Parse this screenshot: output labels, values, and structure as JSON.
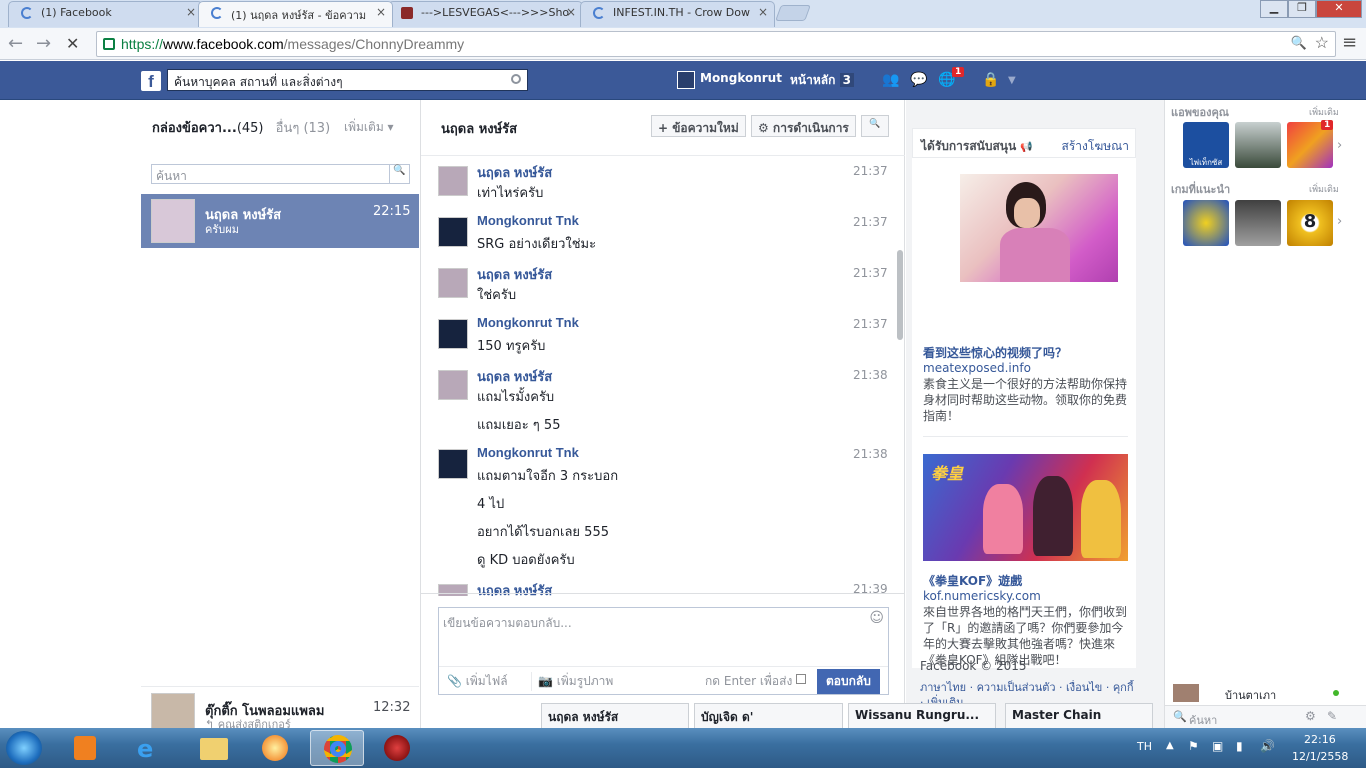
{
  "browser": {
    "tabs": [
      {
        "title": "(1) Facebook",
        "close": "×",
        "active": false
      },
      {
        "title": "(1) นฤดล หงษ์รัส - ข้อความ",
        "close": "×",
        "active": true
      },
      {
        "title": "--->LESVEGAS<--->>>Sho",
        "close": "×",
        "active": false
      },
      {
        "title": "INFEST.IN.TH - Crow Dow",
        "close": "×",
        "active": false
      }
    ],
    "url_scheme": "https://",
    "url_host": "www.facebook.com",
    "url_path": "/messages/ChonnyDreammy",
    "back": "←",
    "forward": "→",
    "stop": "✕",
    "window_buttons": {
      "minimize": "▁",
      "maximize": "❐",
      "close": "✕"
    },
    "zoom_icon": "🔍",
    "star_icon": "☆",
    "menu_icon": "≡"
  },
  "fb": {
    "logo": "f",
    "search_placeholder": "ค้นหาบุคคล สถานที่ และสิ่งต่างๆ",
    "user_name": "Mongkonrut",
    "home_label": "หน้าหลัก",
    "home_count": "3",
    "notif_badge": "1"
  },
  "inbox": {
    "title": "กล่องข้อควา...",
    "count": "(45)",
    "other": "อื่นๆ (13)",
    "more": "เพิ่มเติม ▾",
    "search_placeholder": "ค้นหา",
    "conversations": [
      {
        "name": "นฤดล หงษ์รัส",
        "snippet": "ครับผม",
        "time": "22:15",
        "selected": true
      },
      {
        "name": "ตุ๊กติ๊ก โนพลอมแพลม",
        "snippet": "↰ คุณส่งสติกเกอร์",
        "time": "12:32",
        "selected": false
      }
    ]
  },
  "thread": {
    "title": "นฤดล หงษ์รัส",
    "new_message": "+ ข้อความใหม่",
    "actions": "⚙ การดำเนินการ",
    "search_icon": "🔍",
    "messages": [
      {
        "sender": "นฤดล หงษ์รัส",
        "lines": [
          "เท่าไหร่ครับ"
        ],
        "time": "21:37",
        "dark": false
      },
      {
        "sender": "Mongkonrut Tnk",
        "lines": [
          "SRG อย่างเดียวใช่มะ"
        ],
        "time": "21:37",
        "dark": true
      },
      {
        "sender": "นฤดล หงษ์รัส",
        "lines": [
          "ใช่ครับ"
        ],
        "time": "21:37",
        "dark": false
      },
      {
        "sender": "Mongkonrut Tnk",
        "lines": [
          "150 ทรูครับ"
        ],
        "time": "21:37",
        "dark": true
      },
      {
        "sender": "นฤดล หงษ์รัส",
        "lines": [
          "แถมไรมั้งครับ",
          "แถมเยอะ ๆ 55"
        ],
        "time": "21:38",
        "dark": false
      },
      {
        "sender": "Mongkonrut Tnk",
        "lines": [
          "แถมตามใจอีก 3 กระบอก",
          "4 ไป",
          "อยากได้ไรบอกเลย 555",
          "ดู KD บอดยังครับ"
        ],
        "time": "21:38",
        "dark": true
      },
      {
        "sender": "นฤดล หงษ์รัส",
        "lines": [],
        "time": "21:39",
        "dark": false
      }
    ],
    "reply_placeholder": "เขียนข้อความตอบกลับ...",
    "attach_file": "เพิ่มไฟล์",
    "attach_photo": "เพิ่มรูปภาพ",
    "enter_to_send": "กด Enter เพื่อส่ง",
    "reply_button": "ตอบกลับ",
    "smiley": "☺"
  },
  "ads": {
    "header": "ได้รับการสนับสนุน",
    "create_ad": "สร้างโฆษณา",
    "items": [
      {
        "title": "看到这些惊心的视频了吗？",
        "domain": "meatexposed.info",
        "body": "素食主义是一个很好的方法帮助你保持身材同时帮助这些动物。领取你的免费指南！"
      },
      {
        "title": "《拳皇KOF》遊戲",
        "domain": "kof.numericsky.com",
        "body": "來自世界各地的格鬥天王們，你們收到了「R」的邀請函了嗎？你們要參加今年的大賽去擊敗其他強者嗎？快進來《拳皇KOF》組隊出戰吧！"
      }
    ],
    "footer_copyright": "Facebook © 2015",
    "footer_links": "ภาษาไทย · ความเป็นส่วนตัว · เงื่อนไข · คุกกี้ · เพิ่มเติม"
  },
  "apps": {
    "your_apps": "แอพของคุณ",
    "see_more": "เพิ่มเติม",
    "games_header": "เกมที่แนะนำ",
    "games_more": "เพิ่มเติม",
    "app_badge": "1",
    "apps": [
      {
        "name": "ไพ่เท็กซัส"
      },
      {
        "name": "moto"
      },
      {
        "name": "candy"
      }
    ],
    "games": [
      {
        "name": "CG"
      },
      {
        "name": "Fast Furious"
      },
      {
        "name": "8"
      }
    ],
    "chat_contact": "บ้านตาเภา",
    "chat_search": "ค้นหา"
  },
  "chat_tabs": [
    "นฤดล หงษ์รัส",
    "บัญเจิด ด'",
    "Wissanu Rungru...",
    "Master Chain"
  ],
  "taskbar": {
    "lang": "TH",
    "time": "22:16",
    "date": "12/1/2558"
  }
}
